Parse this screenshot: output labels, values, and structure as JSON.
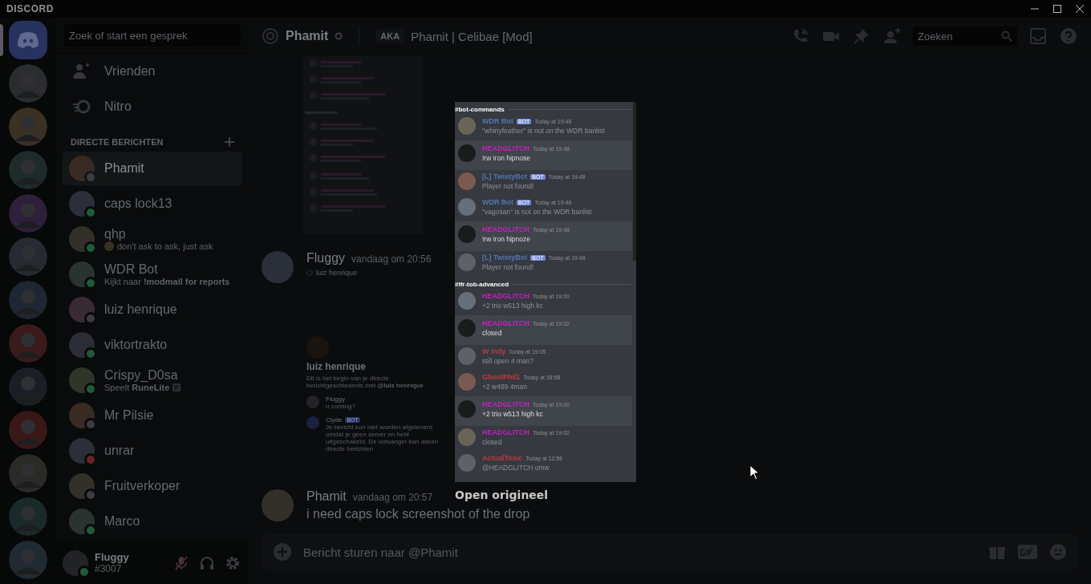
{
  "window": {
    "title": "DISCORD"
  },
  "servers": [
    {
      "kind": "home",
      "selected": true
    },
    {
      "kind": "picture",
      "selected": false
    },
    {
      "kind": "picture",
      "selected": false
    },
    {
      "kind": "picture",
      "selected": false
    },
    {
      "kind": "picture",
      "selected": false
    },
    {
      "kind": "picture",
      "selected": false
    },
    {
      "kind": "picture",
      "selected": false
    },
    {
      "kind": "picture",
      "selected": false
    },
    {
      "kind": "picture",
      "selected": false
    },
    {
      "kind": "picture",
      "selected": false
    },
    {
      "kind": "picture",
      "selected": false
    },
    {
      "kind": "picture",
      "selected": false
    },
    {
      "kind": "picture",
      "selected": false
    }
  ],
  "dm_sidebar": {
    "search_placeholder": "Zoek of start een gesprek",
    "nav": [
      {
        "kind": "friends",
        "label": "Vrienden"
      },
      {
        "kind": "nitro",
        "label": "Nitro"
      }
    ],
    "section_title": "DIRECTE BERICHTEN",
    "dms": [
      {
        "name": "Phamit",
        "color": "#3a3c40",
        "selected": true
      },
      {
        "name": "caps lock13",
        "color": "#1f5a3a",
        "selected": false
      },
      {
        "name": "qhp",
        "color": "#1f5a3a",
        "activity": "don't ask to ask, just ask",
        "kind": "custom",
        "selected": false
      },
      {
        "name": "WDR Bot",
        "color": "#1f5a3a",
        "activity": "Kijkt naar **!modmail for reports**",
        "selected": false
      },
      {
        "name": "luiz henrique",
        "color": "#3a3c40",
        "selected": false
      },
      {
        "name": "viktortrakto",
        "color": "#1f5a3a",
        "selected": false
      },
      {
        "name": "Crispy_D0sa",
        "color": "#1f5a3a",
        "activity": "Speelt **RuneLite**",
        "kind": "game",
        "selected": false
      },
      {
        "name": "Mr Pilsie",
        "color": "#3a3c40",
        "selected": false
      },
      {
        "name": "unrar",
        "color": "#6a2226",
        "selected": false
      },
      {
        "name": "Fruitverkoper",
        "color": "#3a3c40",
        "selected": false
      },
      {
        "name": "Marco",
        "color": "#1f5a3a",
        "selected": false
      }
    ]
  },
  "user_panel": {
    "name": "Fluggy",
    "tag": "#3007",
    "color": "#1f5a3a",
    "muted": true
  },
  "header": {
    "name": "Phamit",
    "color": "#3a3c40",
    "aka_label": "AKA",
    "aka_names": "Phamit | Celibae [Mod]",
    "search_placeholder": "Zoeken"
  },
  "chat": {
    "messages": [
      {
        "kind": "image"
      },
      {
        "kind": "message",
        "author": "Fluggy",
        "time": "vandaag om 20:56",
        "mention": "luiz henrique",
        "embed": {
          "title": "luiz henrique",
          "intro": "Dit is het begin van je directe berichtgeschiedenis met **@luiz henrique**",
          "messages": [
            {
              "author": "Fluggy",
              "text": "u coming?"
            },
            {
              "author": "Clyde",
              "bot_label": "BOT",
              "text": "Je bericht kon niet worden afgeleverd omdat je geen server en hebt uitgeschakeld. De ontvanger kan alleen directe berichten"
            }
          ]
        }
      },
      {
        "kind": "message",
        "author": "Phamit",
        "time": "vandaag om 20:57",
        "text": "i need caps lock screenshot of the drop"
      }
    ],
    "composer_placeholder": "Bericht sturen naar @Phamit"
  },
  "lightbox": {
    "open_link": "Open origineel",
    "sections": [
      {
        "channel": "#bot-commands",
        "messages": [
          {
            "author": "WDR Bot",
            "color": "#4f77b0",
            "bot_label": "BOT",
            "time": "Today at 19:48",
            "text": "\"whinyfeather\" is not on the WDR banlist",
            "highlighted": false
          },
          {
            "author": "HEADGLITCH",
            "color": "#c21fc2",
            "time": "Today at 19:48",
            "text": "!rw iron hipnose",
            "highlighted": true
          },
          {
            "author": "[L] TwistyBot",
            "color": "#4f77b0",
            "bot_label": "BOT",
            "time": "Today at 19:48",
            "text": "Player not found!",
            "highlighted": false
          },
          {
            "author": "WDR Bot",
            "color": "#4f77b0",
            "bot_label": "BOT",
            "time": "Today at 19:48",
            "text": "\"vagosan\" is not on the WDR banlist",
            "highlighted": false
          },
          {
            "author": "HEADGLITCH",
            "color": "#c21fc2",
            "time": "Today at 19:48",
            "text": "!rw iron hipnoze",
            "highlighted": true
          },
          {
            "author": "[L] TwistyBot",
            "color": "#4f77b0",
            "bot_label": "BOT",
            "time": "Today at 19:48",
            "text": "Player not found!",
            "highlighted": false
          }
        ]
      },
      {
        "channel": "#lfr-tob-advanced",
        "messages": [
          {
            "author": "HEADGLITCH",
            "color": "#c21fc2",
            "time": "Today at 19:00",
            "text": "+2 trio w513 high kc",
            "highlighted": false
          },
          {
            "author": "HEADGLITCH",
            "color": "#c21fc2",
            "time": "Today at 19:02",
            "text": "closed",
            "highlighted": true
          },
          {
            "author": "W indy",
            "color": "#b0404f",
            "time": "Today at 19:05",
            "text": "still open 4 man?",
            "highlighted": false
          },
          {
            "author": "GhostPhil1",
            "color": "#c0393b",
            "time": "Today at 18:58",
            "text": "+2 w489 4man",
            "highlighted": false
          },
          {
            "author": "HEADGLITCH",
            "color": "#c21fc2",
            "time": "Today at 19:00",
            "text": "+2 trio w513 high kc",
            "highlighted": true
          },
          {
            "author": "HEADGLITCH",
            "color": "#c21fc2",
            "time": "Today at 19:02",
            "text": "closed",
            "highlighted": false
          },
          {
            "author": "ActualToxic",
            "color": "#c0393b",
            "time": "Today at 12:56",
            "text": "@HEADGLITCH omw",
            "highlighted": false
          }
        ]
      }
    ]
  }
}
